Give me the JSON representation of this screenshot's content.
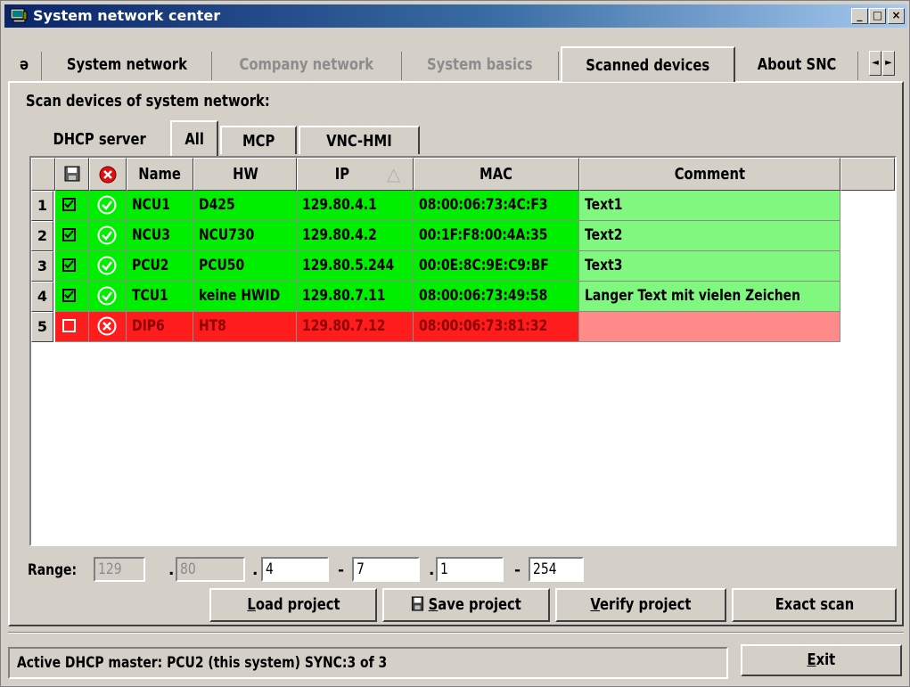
{
  "window": {
    "title": "System network center",
    "icon": "computer-monitor-icon",
    "controls": {
      "minimize": "_",
      "maximize": "□",
      "close": "×"
    }
  },
  "tabs": [
    {
      "label": "ə",
      "state": "partial"
    },
    {
      "label": "System network",
      "state": "normal"
    },
    {
      "label": "Company network",
      "state": "disabled"
    },
    {
      "label": "System basics",
      "state": "disabled"
    },
    {
      "label": "Scanned devices",
      "state": "active"
    },
    {
      "label": "About SNC",
      "state": "normal"
    }
  ],
  "tab_scroll": {
    "left": "◄",
    "right": "►"
  },
  "scan": {
    "heading": "Scan devices of system network:",
    "subtabs": [
      {
        "label": "DHCP server",
        "state": "normal"
      },
      {
        "label": "All",
        "state": "active"
      },
      {
        "label": "MCP",
        "state": "normal"
      },
      {
        "label": "VNC-HMI",
        "state": "normal"
      }
    ]
  },
  "grid": {
    "header_icons": {
      "save": "save-disk-icon",
      "error": "error-x-icon"
    },
    "columns": [
      "Name",
      "HW",
      "IP",
      "MAC",
      "Comment"
    ],
    "sorted_column": "IP",
    "sort_indicator": "△",
    "rows": [
      {
        "num": "1",
        "checked": true,
        "status": "ok",
        "name": "NCU1",
        "hw": "D425",
        "ip": "129.80.4.1",
        "mac": "08:00:06:73:4C:F3",
        "comment": "Text1"
      },
      {
        "num": "2",
        "checked": true,
        "status": "ok",
        "name": "NCU3",
        "hw": "NCU730",
        "ip": "129.80.4.2",
        "mac": "00:1F:F8:00:4A:35",
        "comment": "Text2"
      },
      {
        "num": "3",
        "checked": true,
        "status": "ok",
        "name": "PCU2",
        "hw": "PCU50",
        "ip": "129.80.5.244",
        "mac": "00:0E:8C:9E:C9:BF",
        "comment": "Text3"
      },
      {
        "num": "4",
        "checked": true,
        "status": "ok",
        "name": "TCU1",
        "hw": "keine HWID",
        "ip": "129.80.7.11",
        "mac": "08:00:06:73:49:58",
        "comment": "Langer Text mit vielen Zeichen"
      },
      {
        "num": "5",
        "checked": false,
        "status": "error",
        "name": "DIP6",
        "hw": "HT8",
        "ip": "129.80.7.12",
        "mac": "08:00:06:73:81:32",
        "comment": ""
      }
    ],
    "colors": {
      "ok": "#00ee00",
      "ok_comment": "#80f880",
      "error": "#ff1c1c",
      "error_comment": "#ff8a8a"
    }
  },
  "range": {
    "label": "Range:",
    "octet1": "129",
    "octet2": "80",
    "octet3_from": "4",
    "octet3_to": "7",
    "octet4_from": "1",
    "octet4_to": "254",
    "dot": ".",
    "dash": "-"
  },
  "buttons": {
    "load_project": "Load project",
    "save_project": "Save project",
    "verify_project": "Verify project",
    "exact_scan": "Exact scan",
    "exit": "Exit"
  },
  "status": {
    "text": "Active DHCP master: PCU2 (this system) SYNC:3 of 3"
  }
}
